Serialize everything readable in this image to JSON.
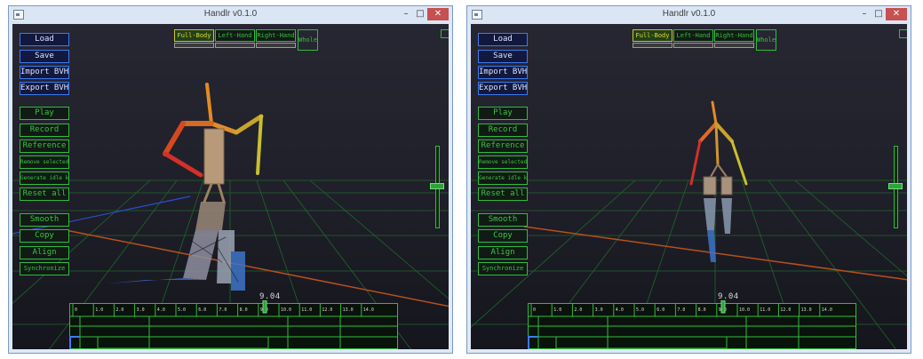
{
  "windows": [
    {
      "title": "Handlr v0.1.0",
      "controls": {
        "minimize": "–",
        "maximize": "□",
        "close": "✕"
      },
      "buttons_blue": [
        "Load",
        "Save",
        "Import BVH",
        "Export BVH"
      ],
      "buttons_green": [
        "Play",
        "Record",
        "Reference",
        "Remove selected",
        "Generate idle keys",
        "Reset all"
      ],
      "buttons_green2": [
        "Smooth",
        "Copy",
        "Align",
        "Synchronize"
      ],
      "tabs": [
        "Full-Body",
        "Left-Hand",
        "Right-Hand"
      ],
      "active_tab": "Full-Body",
      "whole_label": "Whole",
      "time_value": "9.04",
      "timeline_ticks": [
        "0",
        "1.0",
        "2.0",
        "3.0",
        "4.0",
        "5.0",
        "6.0",
        "7.0",
        "8.0",
        "9.0",
        "10.0",
        "11.0",
        "12.0",
        "13.0",
        "14.0"
      ],
      "vertical_slider_level": 0.5,
      "colors": {
        "ui_green": "#2fbd3b",
        "ui_blue": "#3d7af0",
        "active_tab": "#c6c43a",
        "close": "#c75050"
      }
    },
    {
      "title": "Handlr v0.1.0",
      "controls": {
        "minimize": "–",
        "maximize": "□",
        "close": "✕"
      },
      "buttons_blue": [
        "Load",
        "Save",
        "Import BVH",
        "Export BVH"
      ],
      "buttons_green": [
        "Play",
        "Record",
        "Reference",
        "Remove selected",
        "Generate idle keys",
        "Reset all"
      ],
      "buttons_green2": [
        "Smooth",
        "Copy",
        "Align",
        "Synchronize"
      ],
      "tabs": [
        "Full-Body",
        "Left-Hand",
        "Right-Hand"
      ],
      "active_tab": "Full-Body",
      "whole_label": "Whole",
      "time_value": "9.04",
      "timeline_ticks": [
        "0",
        "1.0",
        "2.0",
        "3.0",
        "4.0",
        "5.0",
        "6.0",
        "7.0",
        "8.0",
        "9.0",
        "10.0",
        "11.0",
        "12.0",
        "13.0",
        "14.0"
      ],
      "vertical_slider_level": 0.5,
      "colors": {
        "ui_green": "#2fbd3b",
        "ui_blue": "#3d7af0",
        "active_tab": "#c6c43a",
        "close": "#c75050"
      }
    }
  ]
}
